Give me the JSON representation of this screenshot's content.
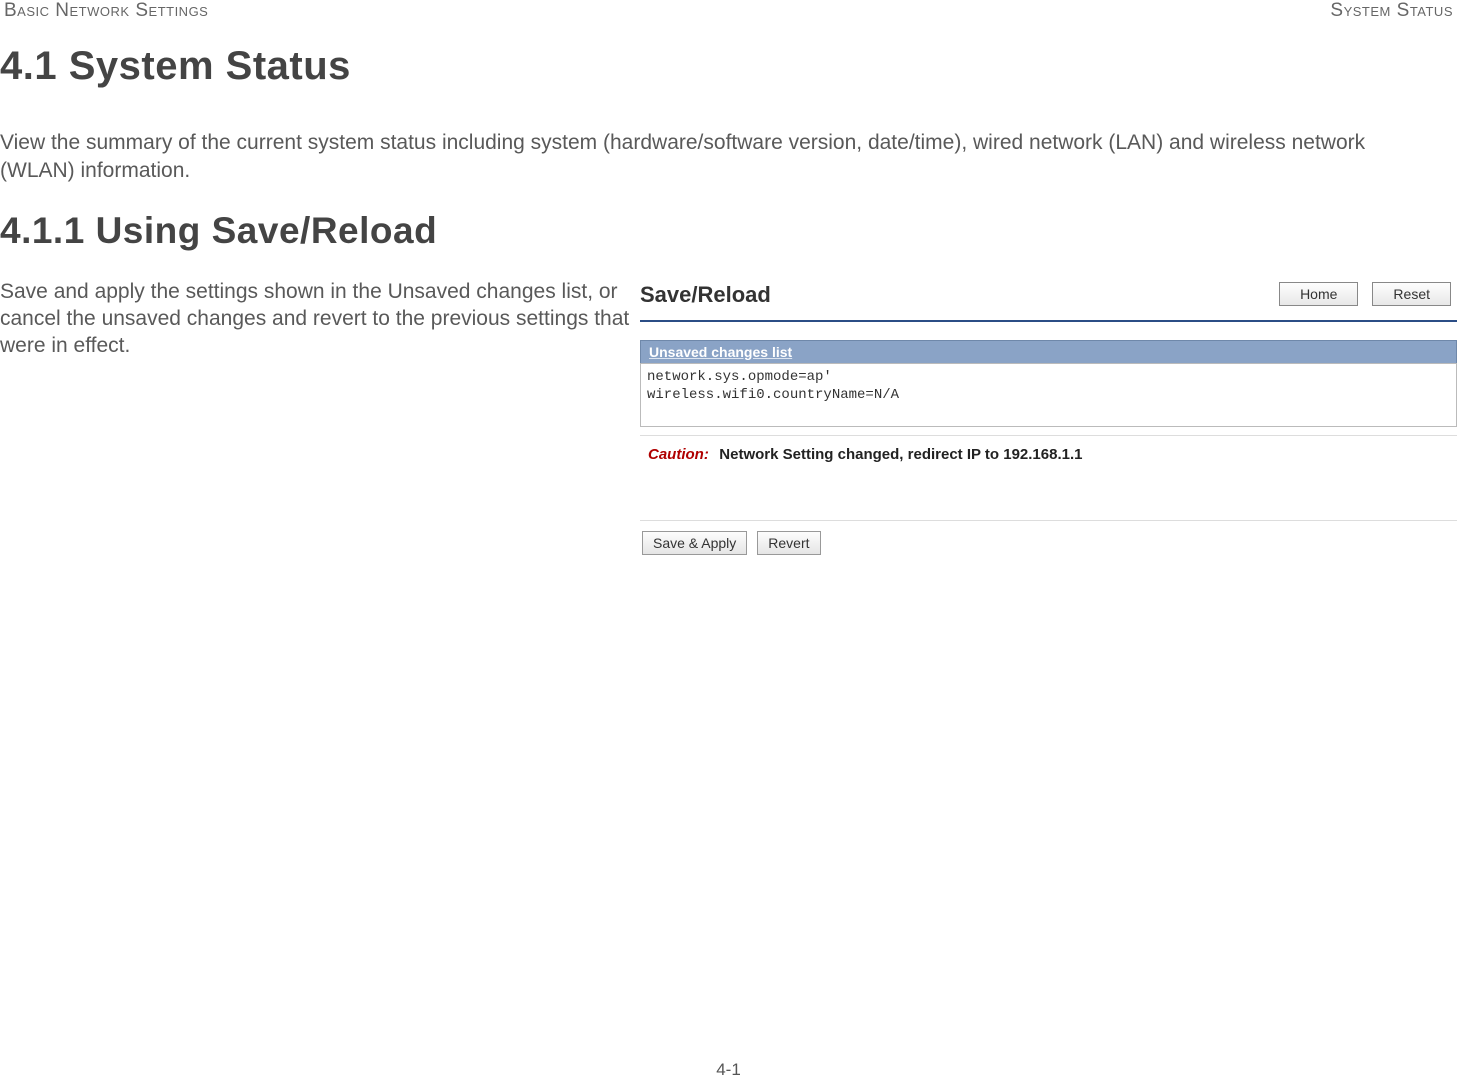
{
  "header": {
    "left": "Basic Network Settings",
    "right": "System Status"
  },
  "section": {
    "number_title": "4.1 System Status",
    "intro": "View the summary of the current system status including system (hardware/software version, date/time), wired network (LAN) and wireless network (WLAN) information."
  },
  "subsection": {
    "number_title": "4.1.1 Using Save/Reload",
    "body": "Save and apply the settings shown in the Unsaved changes list, or cancel the unsaved changes and revert to the previous set­tings that were in effect."
  },
  "figure": {
    "panel_title": "Save/Reload",
    "home_btn": "Home",
    "reset_btn": "Reset",
    "changes_header": "Unsaved changes list",
    "changes_lines": [
      "network.sys.opmode=ap'",
      "wireless.wifi0.countryName=N/A"
    ],
    "caution_label": "Caution:",
    "caution_text": "Network Setting changed, redirect IP to 192.168.1.1",
    "save_apply_btn": "Save & Apply",
    "revert_btn": "Revert"
  },
  "page_number": "4-1"
}
